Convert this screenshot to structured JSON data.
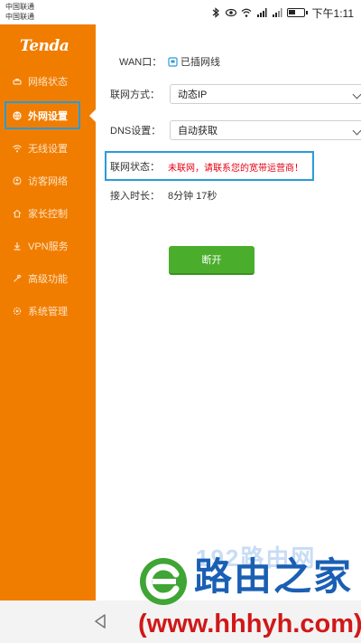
{
  "statusbar": {
    "carrier1": "中国联通",
    "carrier2": "中国联通",
    "time": "下午1:11",
    "battery_level": 0.5
  },
  "sidebar": {
    "logo": "Tenda",
    "items": [
      {
        "label": "网络状态",
        "icon": "network-icon"
      },
      {
        "label": "外网设置",
        "icon": "globe-icon",
        "active": true
      },
      {
        "label": "无线设置",
        "icon": "wifi-icon"
      },
      {
        "label": "访客网络",
        "icon": "guest-icon"
      },
      {
        "label": "家长控制",
        "icon": "home-icon"
      },
      {
        "label": "VPN服务",
        "icon": "vpn-icon"
      },
      {
        "label": "高级功能",
        "icon": "wrench-icon"
      },
      {
        "label": "系统管理",
        "icon": "gear-icon"
      }
    ]
  },
  "main": {
    "wan": {
      "label": "WAN口：",
      "value": "已插网线"
    },
    "connection_type": {
      "label": "联网方式：",
      "value": "动态IP"
    },
    "dns": {
      "label": "DNS设置：",
      "value": "自动获取"
    },
    "net_status": {
      "label": "联网状态：",
      "value": "未联网，请联系您的宽带运营商！"
    },
    "duration": {
      "label": "接入时长：",
      "value": "8分钟 17秒"
    },
    "disconnect_label": "断开"
  },
  "watermark": {
    "bg_text": "192路由网",
    "title": "路由之家",
    "url": "(www.hhhyh.com)"
  },
  "colors": {
    "brand_orange": "#f07d00",
    "highlight_blue": "#2a9bd8",
    "button_green": "#4aae2c",
    "error_red": "#e60012"
  }
}
